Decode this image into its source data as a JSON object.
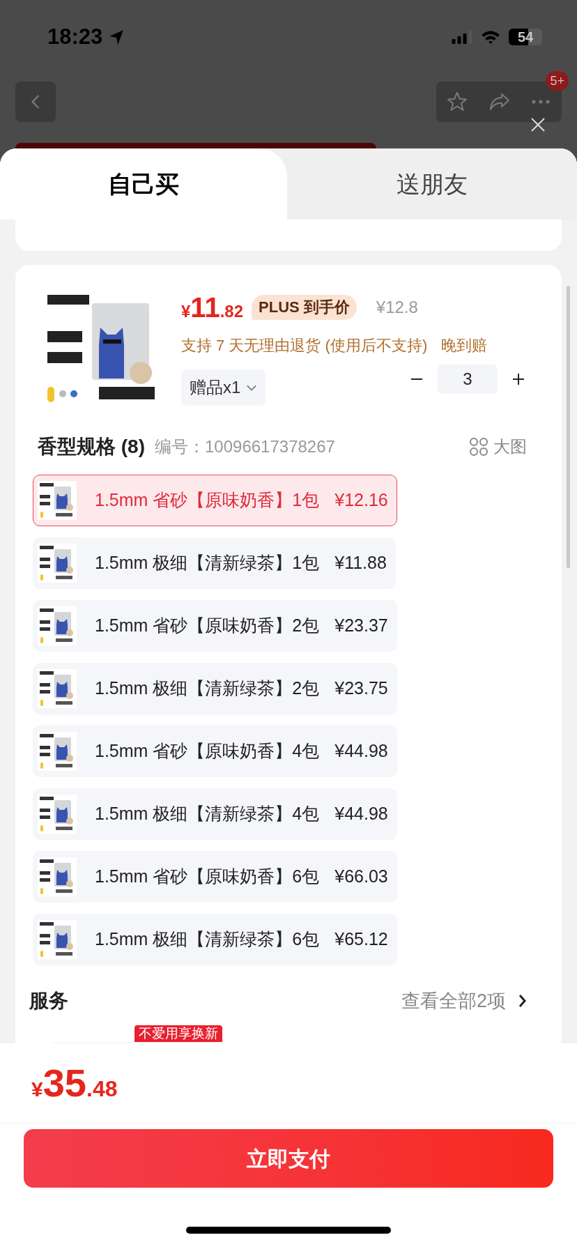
{
  "status_bar": {
    "time": "18:23",
    "battery": "54"
  },
  "nav": {
    "badge": "5+"
  },
  "tabs": [
    {
      "label": "自己买",
      "selected": true
    },
    {
      "label": "送朋友",
      "selected": false
    }
  ],
  "product": {
    "currency": "¥",
    "price_int": "11",
    "price_dec": ".82",
    "plus_label": "PLUS 到手价",
    "original_price": "¥12.8",
    "support": "支持 7 天无理由退货 (使用后不支持)",
    "late": "晚到赔",
    "gift": "赠品x1",
    "quantity": "3"
  },
  "spec": {
    "title": "香型规格 (8)",
    "code_label": "编号：",
    "code": "10096617378267",
    "view_label": "大图",
    "options": [
      {
        "label": "1.5mm 省砂【原味奶香】1包",
        "price": "¥12.16",
        "selected": true
      },
      {
        "label": "1.5mm 极细【清新绿茶】1包",
        "price": "¥11.88",
        "selected": false
      },
      {
        "label": "1.5mm 省砂【原味奶香】2包",
        "price": "¥23.37",
        "selected": false
      },
      {
        "label": "1.5mm 极细【清新绿茶】2包",
        "price": "¥23.75",
        "selected": false
      },
      {
        "label": "1.5mm 省砂【原味奶香】4包",
        "price": "¥44.98",
        "selected": false
      },
      {
        "label": "1.5mm 极细【清新绿茶】4包",
        "price": "¥44.98",
        "selected": false
      },
      {
        "label": "1.5mm 省砂【原味奶香】6包",
        "price": "¥66.03",
        "selected": false
      },
      {
        "label": "1.5mm 极细【清新绿茶】6包",
        "price": "¥65.12",
        "selected": false
      }
    ]
  },
  "services": {
    "title": "服务",
    "more": "查看全部2项",
    "tag": "不爱用享换新"
  },
  "footer": {
    "currency": "¥",
    "amount_int": "35",
    "amount_dec": ".48",
    "pay_button": "立即支付"
  }
}
